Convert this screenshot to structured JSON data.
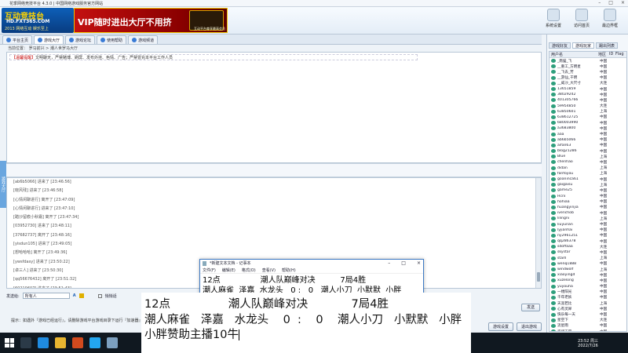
{
  "window": {
    "title": "花季网络竞技平台 4.3.0 | 中国网络游戏服务官方网站"
  },
  "header": {
    "logo_line1": "互动竞技台",
    "logo_line2": "HD.FXT365.COM",
    "logo_line3": "2013 网络互动 娱乐至上",
    "banner_text": "VIP随时进出大厅不用挤",
    "banner_sub": "互动平台尊享最高会员",
    "tools": [
      {
        "label": "系统设置"
      },
      {
        "label": "访问首页"
      },
      {
        "label": "最边界框"
      }
    ]
  },
  "nav": {
    "tabs": [
      {
        "label": "平台主页"
      },
      {
        "label": "游戏大厅"
      },
      {
        "label": "游戏论坛"
      },
      {
        "label": "使用帮助"
      },
      {
        "label": "游戏频道"
      }
    ]
  },
  "breadcrumb": "当前位置：  罗马前兴  >  潮人世罗马大厅",
  "room": {
    "notice_prefix": "【温馨提醒】",
    "notice_text": "文明聊天，严禁赌博、刷屏、发布外挂、色情、广告；严禁冒充本平台工作人员"
  },
  "sidepanel": {
    "label": "游戏大厅"
  },
  "log": {
    "rows": [
      "[ab6b5066] 进来了 [23:46:56]",
      "[晓风残] 进来了 [23:46:58]",
      "[心情闲聊进行] 离开了 [23:47:09]",
      "[心情闲聊进行] 进来了 [23:47:10]",
      "[踏沙留痕小秋霜] 离开了 [23:47:34]",
      "[03952730] 进来了 [23:48:11]",
      "[37682737] 离开了 [23:48:16]",
      "[yisdun105] 进来了 [23:49:05]",
      "[想哈哈哈] 离开了 [23:49:36]",
      "[ywsfdasy] 进来了 [23:50:22]",
      "[卓三人] 进来了 [23:50:30]",
      "[qq56676432] 离开了 [23:51:32]",
      "[60210607] 进来了 [23:51:43]"
    ]
  },
  "sendbar": {
    "target_label": "发送给:",
    "target_value": "所有人",
    "private_label": "悄悄话",
    "send_label": "发送"
  },
  "hint": {
    "text": "提示：如遇外『游戏已经运行』，请删除游戏平台游戏目录下运行『加速器』等"
  },
  "bottom_buttons": [
    "游戏设置",
    "退出游戏"
  ],
  "right": {
    "tabs": [
      "游戏好友",
      "游戏玩家",
      "踢出列表"
    ],
    "columns": [
      "用户名",
      "",
      "地区",
      "ID",
      "Flag"
    ],
    "users": [
      {
        "name": "_南猫_飞",
        "pr": "",
        "area": "中国",
        "dm": "",
        "ri": ""
      },
      {
        "name": "__重工_方明星",
        "pr": "",
        "area": "中国",
        "dm": "",
        "ri": ""
      },
      {
        "name": "__飞去_芳",
        "pr": "",
        "area": "中国",
        "dm": "",
        "ri": ""
      },
      {
        "name": "__游仙_干明",
        "pr": "",
        "area": "中国",
        "dm": "",
        "ri": ""
      },
      {
        "name": "__威沙_大尺寸",
        "pr": "",
        "area": "大连",
        "dm": "",
        "ri": ""
      },
      {
        "name": "13651859",
        "pr": "",
        "area": "中国",
        "dm": "",
        "ri": ""
      },
      {
        "name": "38029242",
        "pr": "",
        "area": "中国",
        "dm": "",
        "ri": ""
      },
      {
        "name": "401305766",
        "pr": "",
        "area": "中国",
        "dm": "",
        "ri": ""
      },
      {
        "name": "59954850",
        "pr": "",
        "area": "大连",
        "dm": "",
        "ri": ""
      },
      {
        "name": "63850601",
        "pr": "",
        "area": "上海",
        "dm": "",
        "ri": ""
      },
      {
        "name": "638612725",
        "pr": "",
        "area": "中国",
        "dm": "",
        "ri": ""
      },
      {
        "name": "680003990",
        "pr": "",
        "area": "中国",
        "dm": "",
        "ri": ""
      },
      {
        "name": "a3683800",
        "pr": "",
        "area": "中国",
        "dm": "",
        "ri": ""
      },
      {
        "name": "aaa",
        "pr": "",
        "area": "中国",
        "dm": "",
        "ri": ""
      },
      {
        "name": "ab6b5066",
        "pr": "",
        "area": "中国",
        "dm": "",
        "ri": ""
      },
      {
        "name": "aifan63",
        "pr": "",
        "area": "中国",
        "dm": "",
        "ri": ""
      },
      {
        "name": "blog21286",
        "pr": "",
        "area": "中国",
        "dm": "",
        "ri": ""
      },
      {
        "name": "Blue",
        "pr": "",
        "area": "上海",
        "dm": "",
        "ri": ""
      },
      {
        "name": "chenhao",
        "pr": "",
        "area": "中国",
        "dm": "",
        "ri": ""
      },
      {
        "name": "didan",
        "pr": "",
        "area": "上海",
        "dm": "",
        "ri": ""
      },
      {
        "name": "fanfoyou",
        "pr": "",
        "area": "上海",
        "dm": "",
        "ri": ""
      },
      {
        "name": "goaninca61",
        "pr": "",
        "area": "中国",
        "dm": "",
        "ri": ""
      },
      {
        "name": "gaigaisu",
        "pr": "",
        "area": "上海",
        "dm": "",
        "ri": ""
      },
      {
        "name": "game25",
        "pr": "",
        "area": "中国",
        "dm": "",
        "ri": ""
      },
      {
        "name": "Hcrx",
        "pr": "",
        "area": "中国",
        "dm": "",
        "ri": ""
      },
      {
        "name": "hohiaa",
        "pr": "",
        "area": "中国",
        "dm": "",
        "ri": ""
      },
      {
        "name": "huangyinjia",
        "pr": "",
        "area": "中国",
        "dm": "",
        "ri": ""
      },
      {
        "name": "ivenchob",
        "pr": "",
        "area": "中国",
        "dm": "",
        "ri": ""
      },
      {
        "name": "lilingni",
        "pr": "",
        "area": "上海",
        "dm": "",
        "ri": ""
      },
      {
        "name": "liuyunan",
        "pr": "",
        "area": "中国",
        "dm": "",
        "ri": ""
      },
      {
        "name": "lyjianhai",
        "pr": "",
        "area": "中国",
        "dm": "",
        "ri": ""
      },
      {
        "name": "ny2961251",
        "pr": "",
        "area": "中国",
        "dm": "",
        "ri": ""
      },
      {
        "name": "qq286378",
        "pr": "",
        "area": "中国",
        "dm": "",
        "ri": ""
      },
      {
        "name": "sdoffaaa",
        "pr": "",
        "area": "大连",
        "dm": "",
        "ri": ""
      },
      {
        "name": "skystar",
        "pr": "",
        "area": "中国",
        "dm": "",
        "ri": ""
      },
      {
        "name": "starll",
        "pr": "",
        "area": "上海",
        "dm": "",
        "ri": ""
      },
      {
        "name": "wenq1888",
        "pr": "",
        "area": "中国",
        "dm": "",
        "ri": ""
      },
      {
        "name": "windwolf",
        "pr": "",
        "area": "上海",
        "dm": "",
        "ri": ""
      },
      {
        "name": "xiaoyingd",
        "pr": "",
        "area": "中国",
        "dm": "",
        "ri": ""
      },
      {
        "name": "xuzelong",
        "pr": "",
        "area": "中国",
        "dm": "",
        "ri": ""
      },
      {
        "name": "yuyouha",
        "pr": "",
        "area": "中国",
        "dm": "",
        "ri": ""
      },
      {
        "name": "一缕阳光",
        "pr": "",
        "area": "中国",
        "dm": "",
        "ri": ""
      },
      {
        "name": "千年老妖",
        "pr": "",
        "area": "中国",
        "dm": "",
        "ri": ""
      },
      {
        "name": "天涯若比",
        "pr": "",
        "area": "上海",
        "dm": "",
        "ri": ""
      },
      {
        "name": "心有灵犀",
        "pr": "",
        "area": "中国",
        "dm": "",
        "ri": ""
      },
      {
        "name": "快乐每一天",
        "pr": "",
        "area": "中国",
        "dm": "",
        "ri": ""
      },
      {
        "name": "星空下",
        "pr": "",
        "area": "大连",
        "dm": "",
        "ri": ""
      },
      {
        "name": "流星雨",
        "pr": "",
        "area": "中国",
        "dm": "",
        "ri": ""
      },
      {
        "name": "海阔天空",
        "pr": "",
        "area": "中国",
        "dm": "",
        "ri": ""
      },
      {
        "name": "黑色星期五",
        "pr": "",
        "area": "中国",
        "dm": "",
        "ri": ""
      }
    ]
  },
  "taskbar": {
    "time": "23:52 周三",
    "date": "2022/7/26"
  },
  "notepad": {
    "title": "*新建文本文档 - 记事本",
    "menu": [
      "文件(F)",
      "编辑(E)",
      "格式(O)",
      "查看(V)",
      "帮助(H)"
    ],
    "lines": [
      "12点                潮人队巅峰对决          7局4胜",
      "潮人麻雀  泽嘉  水龙头   0 :   0   潮人小刀  小默默  小胖"
    ]
  },
  "overlay": {
    "lines": [
      "12点                潮人队巅峰对决            7局4胜",
      "潮人麻雀   泽嘉   水龙头    0  :    0    潮人小刀   小默默   小胖",
      "小胖赞助主播10牛"
    ]
  }
}
